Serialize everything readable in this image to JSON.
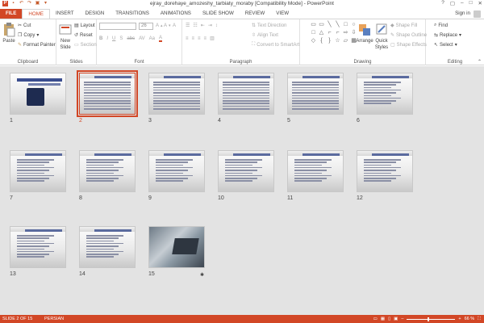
{
  "window": {
    "title": "ejray_dorehaye_amozeshy_tarbiaty_moraby [Compatibility Mode] - PowerPoint",
    "controls": [
      "?",
      "▢",
      "–",
      "□",
      "✕"
    ]
  },
  "tabs": [
    {
      "label": "FILE"
    },
    {
      "label": "HOME"
    },
    {
      "label": "INSERT"
    },
    {
      "label": "DESIGN"
    },
    {
      "label": "TRANSITIONS"
    },
    {
      "label": "ANIMATIONS"
    },
    {
      "label": "SLIDE SHOW"
    },
    {
      "label": "REVIEW"
    },
    {
      "label": "VIEW"
    }
  ],
  "signin": "Sign in",
  "ribbon": {
    "clipboard": {
      "label": "Clipboard",
      "paste": "Paste",
      "cut": "Cut",
      "copy": "Copy",
      "format_painter": "Format Painter"
    },
    "slides": {
      "label": "Slides",
      "new_slide": "New",
      "new_slide2": "Slide",
      "layout": "Layout",
      "reset": "Reset",
      "section": "Section"
    },
    "font": {
      "label": "Font",
      "size": "26",
      "buttons": [
        "B",
        "I",
        "U",
        "S",
        "abc",
        "AV",
        "Aa",
        "A"
      ]
    },
    "paragraph": {
      "label": "Paragraph",
      "text_direction": "Text Direction",
      "align_text": "Align Text",
      "smartart": "Convert to SmartArt"
    },
    "drawing": {
      "label": "Drawing",
      "arrange": "Arrange",
      "quick_styles": "Quick",
      "quick_styles2": "Styles",
      "shape_fill": "Shape Fill",
      "shape_outline": "Shape Outline",
      "shape_effects": "Shape Effects",
      "shapes": [
        "▭",
        "▭",
        "╲",
        "╲",
        "□",
        "○",
        "□",
        "△",
        "⌐",
        "⌐",
        "⇨",
        "⇩",
        "◇",
        "{",
        "}",
        "☆",
        "▱",
        "▦"
      ]
    },
    "editing": {
      "label": "Editing",
      "find": "Find",
      "replace": "Replace",
      "select": "Select"
    }
  },
  "slides": [
    {
      "num": "1",
      "kind": "title"
    },
    {
      "num": "2",
      "kind": "text",
      "selected": true
    },
    {
      "num": "3",
      "kind": "text"
    },
    {
      "num": "4",
      "kind": "text"
    },
    {
      "num": "5",
      "kind": "text"
    },
    {
      "num": "6",
      "kind": "list"
    },
    {
      "num": "7",
      "kind": "list"
    },
    {
      "num": "8",
      "kind": "list"
    },
    {
      "num": "9",
      "kind": "list"
    },
    {
      "num": "10",
      "kind": "list"
    },
    {
      "num": "11",
      "kind": "list"
    },
    {
      "num": "12",
      "kind": "list"
    },
    {
      "num": "13",
      "kind": "list"
    },
    {
      "num": "14",
      "kind": "list"
    },
    {
      "num": "15",
      "kind": "photo"
    }
  ],
  "status": {
    "slide": "SLIDE 2 OF 15",
    "language": "PERSIAN",
    "zoom": "66 %"
  },
  "colors": {
    "accent": "#d24726",
    "title_blue": "#3a4d8f"
  }
}
